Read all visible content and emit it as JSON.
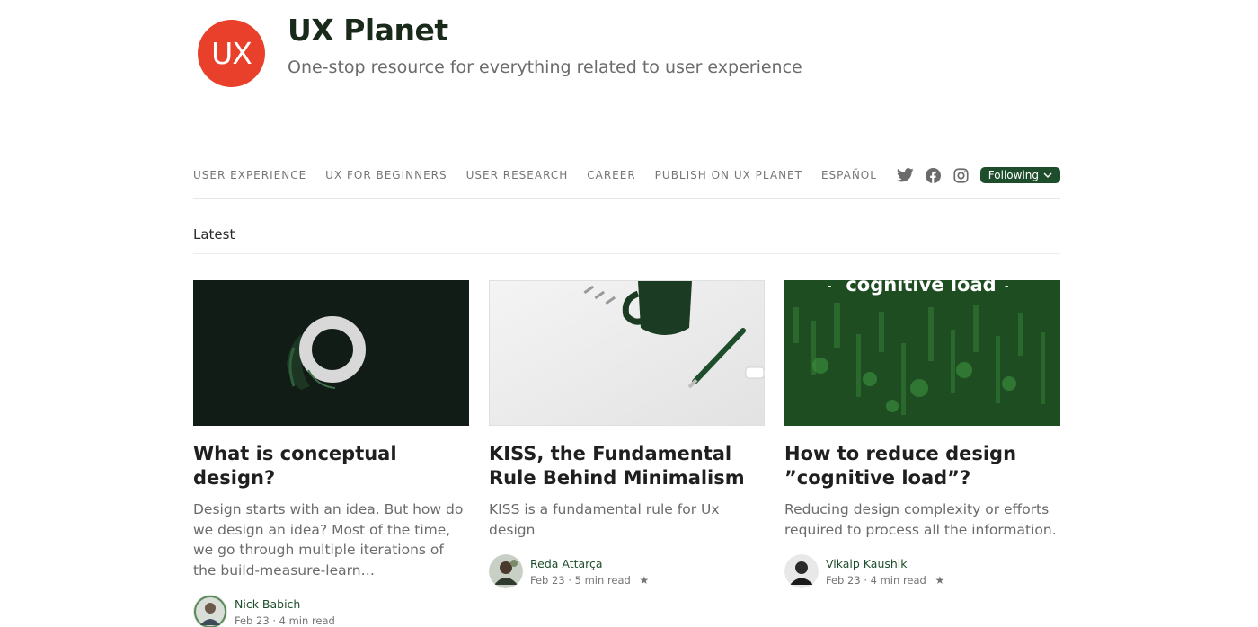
{
  "publication": {
    "logo_text": "UX",
    "name": "UX Planet",
    "tagline": "One-stop resource for everything related to user experience",
    "accent": "#e8402b"
  },
  "nav": {
    "links": [
      "USER EXPERIENCE",
      "UX FOR BEGINNERS",
      "USER RESEARCH",
      "CAREER",
      "PUBLISH ON UX PLANET",
      "ESPAÑOL"
    ],
    "social_icons": [
      "twitter-icon",
      "facebook-icon",
      "instagram-icon"
    ],
    "following_label": "Following",
    "following_color": "#1e4d2b"
  },
  "section": {
    "label": "Latest"
  },
  "cards": [
    {
      "image": "dark-ring-illustration",
      "title": "What is conceptual design?",
      "description": "Design starts with an idea. But how do we design an idea? Most of the time, we go through multiple iterations of the build-measure-learn…",
      "author": "Nick Babich",
      "date": "Feb 23",
      "read_time": "4 min read",
      "starred": false
    },
    {
      "image": "mug-and-pen-photo",
      "title": "KISS, the Fundamental Rule Behind Minimalism",
      "description": "KISS is a fundamental rule for Ux design",
      "author": "Reda Attarça",
      "date": "Feb 23",
      "read_time": "5 min read",
      "starred": true
    },
    {
      "image": "cognitive-load-green-illustration",
      "image_text": "cognitive load",
      "title": "How to reduce design ”cognitive load”?",
      "description": "Reducing design complexity or efforts required to process all the information.",
      "author": "Vikalp Kaushik",
      "date": "Feb 23",
      "read_time": "4 min read",
      "starred": true
    }
  ],
  "meta_separator": "·",
  "star_glyph": "★"
}
